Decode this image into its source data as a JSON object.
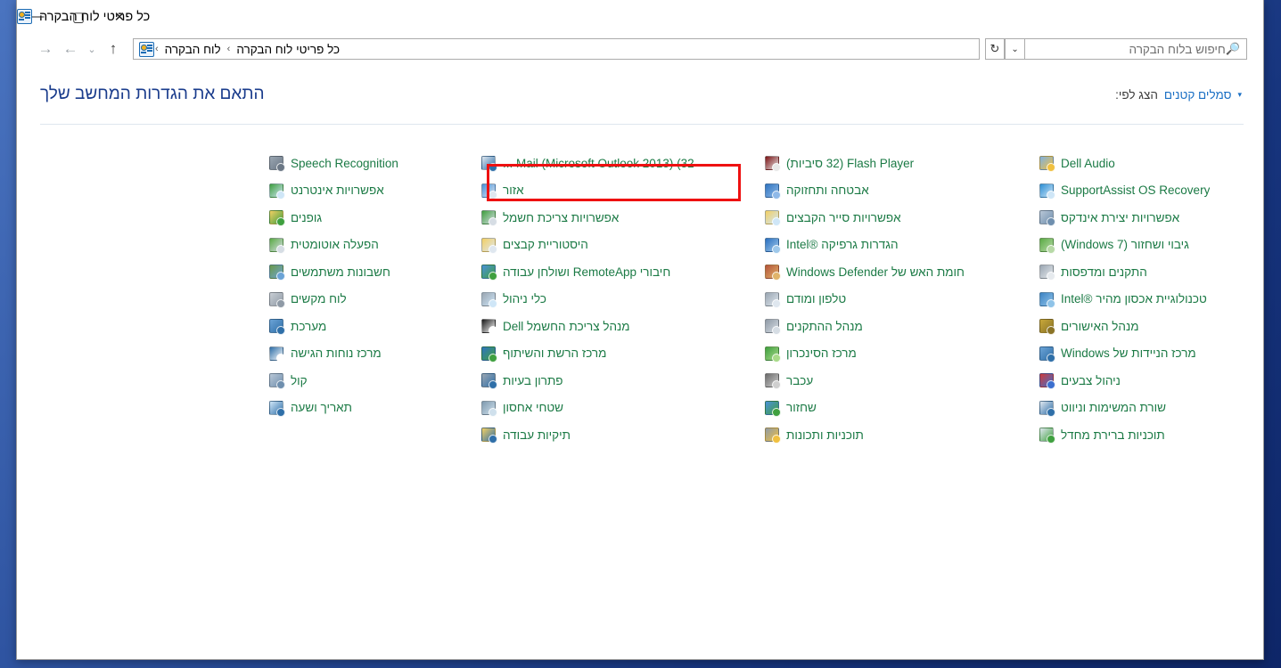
{
  "window": {
    "title": "כל פריטי לוח הבקרה",
    "title_icon": "control-panel-icon",
    "controls": {
      "close": "✕",
      "maximize": "▢",
      "minimize": "—"
    }
  },
  "navbar": {
    "back_arrow": "←",
    "forward_arrow": "→",
    "recent_caret": "⌄",
    "up_arrow": "↑",
    "breadcrumb": {
      "icon": "control-panel-icon",
      "items": [
        "לוח הבקרה",
        "כל פריטי לוח הבקרה"
      ],
      "separator": "›"
    },
    "refresh": "↻",
    "history_caret": "⌄",
    "search": {
      "placeholder": "חיפוש בלוח הבקרה",
      "value": "",
      "icon": "search-icon"
    }
  },
  "header": {
    "page_title": "התאם את הגדרות המחשב שלך",
    "view_by_label": "הצג לפי:",
    "view_by_value": "סמלים קטנים",
    "view_by_caret": "▾"
  },
  "highlight": {
    "target": "Mail (Microsoft Outlook 2013) (32 ...",
    "color": "#ee1111"
  },
  "colors": {
    "link": "#1b7a45",
    "title_blue": "#1a3c8c",
    "accent_blue": "#1a6fc4",
    "highlight_red": "#ee1111",
    "desktop_blue": "#2e53a0"
  },
  "columns": [
    {
      "name": "column-1",
      "items": [
        {
          "label": "Dell Audio",
          "icon": "dell-audio-icon",
          "c1": "#7fb0e0",
          "c2": "#f0c040"
        },
        {
          "label": "SupportAssist OS Recovery",
          "icon": "supportassist-icon",
          "c1": "#2d8fd5",
          "c2": "#cfe6f7"
        },
        {
          "label": "אפשרויות יצירת אינדקס",
          "icon": "indexing-options-icon",
          "c1": "#b9c7d6",
          "c2": "#6f8fae"
        },
        {
          "label": "גיבוי ושחזור (Windows 7)",
          "icon": "backup-restore-icon",
          "c1": "#5aab45",
          "c2": "#b7d9a6"
        },
        {
          "label": "התקנים ומדפסות",
          "icon": "devices-printers-icon",
          "c1": "#9aa6b2",
          "c2": "#e6eaee"
        },
        {
          "label": "טכנולוגיית אכסון מהיר ®Intel",
          "icon": "intel-rapid-storage-icon",
          "c1": "#3c83c4",
          "c2": "#8fc3e8"
        },
        {
          "label": "מנהל האישורים",
          "icon": "credential-manager-icon",
          "c1": "#c9a83a",
          "c2": "#8a7326"
        },
        {
          "label": "מרכז הניידות של Windows",
          "icon": "mobility-center-icon",
          "c1": "#6ba3d6",
          "c2": "#2f6fa8"
        },
        {
          "label": "ניהול צבעים",
          "icon": "color-management-icon",
          "c1": "#cf3b3b",
          "c2": "#3b6fcf"
        },
        {
          "label": "שורת המשימות וניווט",
          "icon": "taskbar-navigation-icon",
          "c1": "#dfe7ef",
          "c2": "#2f6fa8"
        },
        {
          "label": "תוכניות ברירת מחדל",
          "icon": "default-programs-icon",
          "c1": "#dfe7ef",
          "c2": "#3fa03f"
        }
      ]
    },
    {
      "name": "column-2",
      "items": [
        {
          "label": "Flash Player (32 סיביות)",
          "icon": "flash-player-icon",
          "c1": "#7d1416",
          "c2": "#e8e8e8"
        },
        {
          "label": "אבטחה ותחזוקה",
          "icon": "security-maintenance-icon",
          "c1": "#2f74c0",
          "c2": "#8fb9e8"
        },
        {
          "label": "אפשרויות סייר הקבצים",
          "icon": "file-explorer-options-icon",
          "c1": "#f2cf63",
          "c2": "#cfe6f7"
        },
        {
          "label": "הגדרות גרפיקה ®Intel",
          "icon": "intel-graphics-icon",
          "c1": "#2a6fc0",
          "c2": "#9ec8ea"
        },
        {
          "label": "חומת האש של Windows Defender",
          "icon": "windows-firewall-icon",
          "c1": "#b5533a",
          "c2": "#e0b46a"
        },
        {
          "label": "טלפון ומודם",
          "icon": "phone-modem-icon",
          "c1": "#9aa6b2",
          "c2": "#dfe7ef"
        },
        {
          "label": "מנהל ההתקנים",
          "icon": "device-manager-icon",
          "c1": "#8f9aa6",
          "c2": "#d6dde4"
        },
        {
          "label": "מרכז הסינכרון",
          "icon": "sync-center-icon",
          "c1": "#3fa03f",
          "c2": "#a8da88"
        },
        {
          "label": "עכבר",
          "icon": "mouse-icon",
          "c1": "#6b6b6b",
          "c2": "#cfcfcf"
        },
        {
          "label": "שחזור",
          "icon": "recovery-icon",
          "c1": "#4a90d9",
          "c2": "#3fa03f"
        },
        {
          "label": "תוכניות ותכונות",
          "icon": "programs-features-icon",
          "c1": "#8f9aa6",
          "c2": "#f0c040"
        }
      ]
    },
    {
      "name": "column-3",
      "items": [
        {
          "label": "Mail (Microsoft Outlook 2013) (32 ...",
          "icon": "mail-outlook-icon",
          "c1": "#dfe7ef",
          "c2": "#2f6fa8",
          "highlighted": true
        },
        {
          "label": "אזור",
          "icon": "region-icon",
          "c1": "#4a90d9",
          "c2": "#dfe7ef"
        },
        {
          "label": "אפשרויות צריכת חשמל",
          "icon": "power-options-icon",
          "c1": "#3fa03f",
          "c2": "#d6dde4"
        },
        {
          "label": "היסטוריית קבצים",
          "icon": "file-history-icon",
          "c1": "#f2cf63",
          "c2": "#dfe7ef"
        },
        {
          "label": "חיבורי RemoteApp ושולחן עבודה",
          "icon": "remoteapp-connections-icon",
          "c1": "#4a90d9",
          "c2": "#3fa03f"
        },
        {
          "label": "כלי ניהול",
          "icon": "administrative-tools-icon",
          "c1": "#9aa6b2",
          "c2": "#cfe6f7"
        },
        {
          "label": "מנהל צריכת החשמל Dell",
          "icon": "dell-power-manager-icon",
          "c1": "#1a1a1a",
          "c2": "#ffffff"
        },
        {
          "label": "מרכז הרשת והשיתוף",
          "icon": "network-sharing-center-icon",
          "c1": "#2f74c0",
          "c2": "#3fa03f"
        },
        {
          "label": "פתרון בעיות",
          "icon": "troubleshooting-icon",
          "c1": "#9aa6b2",
          "c2": "#2f6fa8"
        },
        {
          "label": "שטחי אחסון",
          "icon": "storage-spaces-icon",
          "c1": "#7f9aaf",
          "c2": "#cfe0ec"
        },
        {
          "label": "תיקיות עבודה",
          "icon": "work-folders-icon",
          "c1": "#f2cf63",
          "c2": "#2f6fa8"
        }
      ]
    },
    {
      "name": "column-4",
      "items": [
        {
          "label": "Speech Recognition",
          "icon": "speech-recognition-icon",
          "c1": "#9aa6b2",
          "c2": "#6b7785"
        },
        {
          "label": "אפשרויות אינטרנט",
          "icon": "internet-options-icon",
          "c1": "#3fa03f",
          "c2": "#cfe6f7"
        },
        {
          "label": "גופנים",
          "icon": "fonts-icon",
          "c1": "#f2cf63",
          "c2": "#3fa03f"
        },
        {
          "label": "הפעלה אוטומטית",
          "icon": "autoplay-icon",
          "c1": "#5aab45",
          "c2": "#d6dde4"
        },
        {
          "label": "חשבונות משתמשים",
          "icon": "user-accounts-icon",
          "c1": "#6b9a4a",
          "c2": "#6ba3d6"
        },
        {
          "label": "לוח מקשים",
          "icon": "keyboard-icon",
          "c1": "#c9ced4",
          "c2": "#8f9aa6"
        },
        {
          "label": "מערכת",
          "icon": "system-icon",
          "c1": "#6ba3d6",
          "c2": "#2f6fa8"
        },
        {
          "label": "מרכז נוחות הגישה",
          "icon": "ease-of-access-icon",
          "c1": "#2f6fa8",
          "c2": "#ffffff"
        },
        {
          "label": "קול",
          "icon": "sound-icon",
          "c1": "#b9c7d6",
          "c2": "#6f8fae"
        },
        {
          "label": "תאריך ושעה",
          "icon": "date-time-icon",
          "c1": "#cfe6f7",
          "c2": "#2f6fa8"
        }
      ]
    }
  ]
}
